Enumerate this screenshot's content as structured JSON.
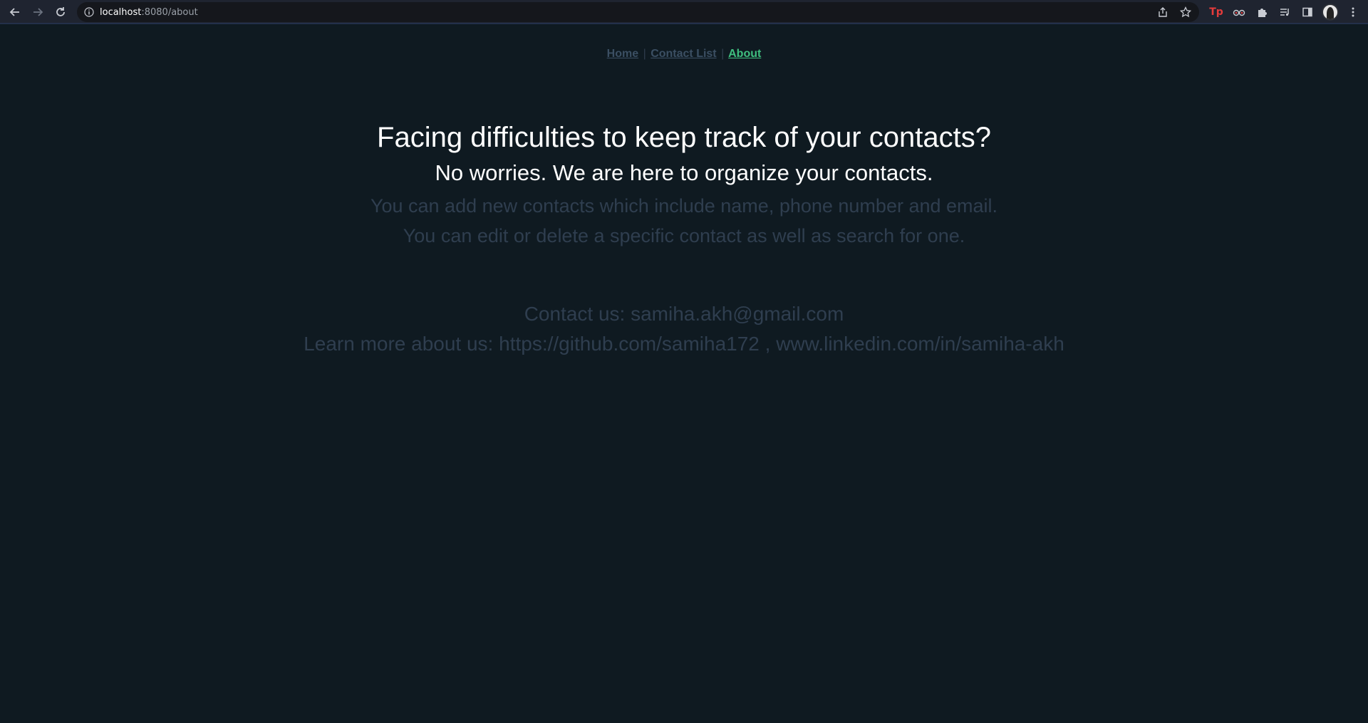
{
  "browser": {
    "url_host": "localhost",
    "url_rest": ":8080/about",
    "extensions": [
      {
        "name": "tp-extension",
        "label": "Tp"
      },
      {
        "name": "eyes-extension-icon"
      },
      {
        "name": "puzzle-icon"
      },
      {
        "name": "reading-list-icon"
      },
      {
        "name": "side-panel-icon"
      },
      {
        "name": "avatar"
      },
      {
        "name": "kebab-menu-icon"
      }
    ]
  },
  "nav": {
    "home": "Home",
    "contact_list": "Contact List",
    "about": "About",
    "separator": "|"
  },
  "content": {
    "headline": "Facing difficulties to keep track of your contacts?",
    "subhead": "No worries. We are here to organize your contacts.",
    "line1": "You can add new contacts which include name, phone number and email.",
    "line2": "You can edit or delete a specific contact as well as search for one.",
    "contact": "Contact us: samiha.akh@gmail.com",
    "learn_more": "Learn more about us: https://github.com/samiha172 , www.linkedin.com/in/samiha-akh"
  },
  "colors": {
    "background": "#0f1a21",
    "active_link": "#3fbf7f",
    "muted_text": "#2f3e4f"
  }
}
